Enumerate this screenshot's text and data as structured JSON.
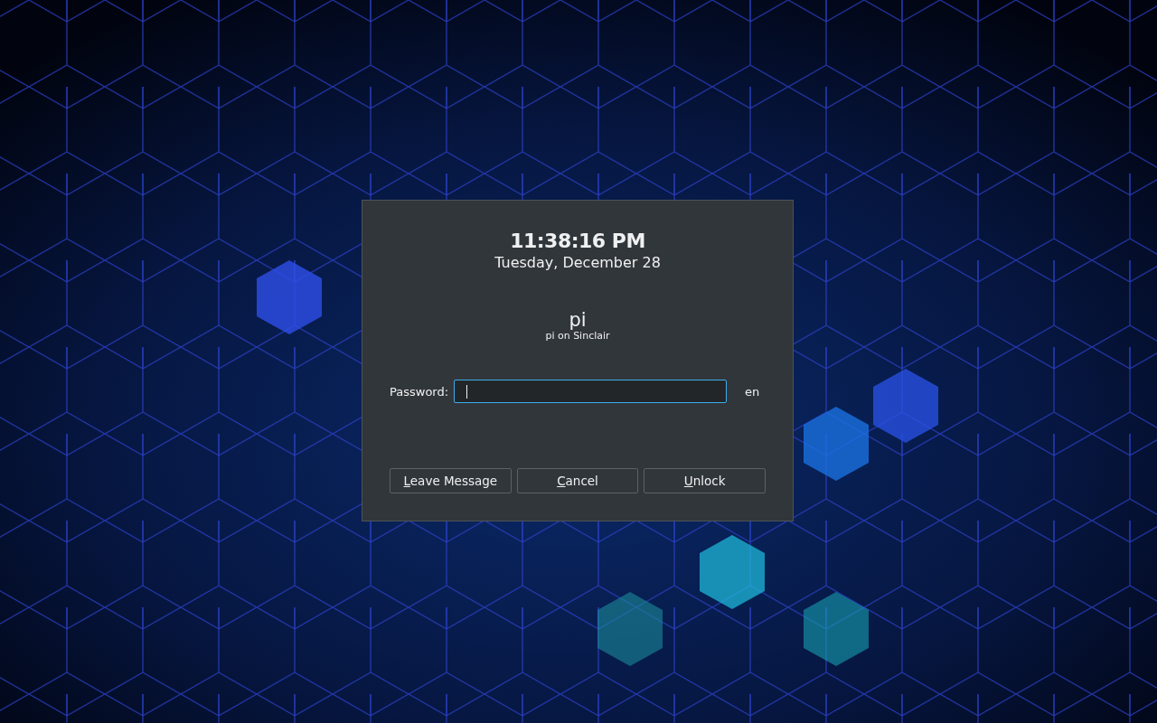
{
  "dialog": {
    "time": "11:38:16 PM",
    "date": "Tuesday, December 28",
    "user": "pi",
    "host": "pi on Sinclair",
    "password": {
      "label": "Password:",
      "focused": true
    },
    "layout": "en",
    "buttons": [
      {
        "mnemonic": "L",
        "rest": "eave Message"
      },
      {
        "mnemonic": "C",
        "rest": "ancel"
      },
      {
        "mnemonic": "U",
        "rest": "nlock"
      }
    ]
  }
}
